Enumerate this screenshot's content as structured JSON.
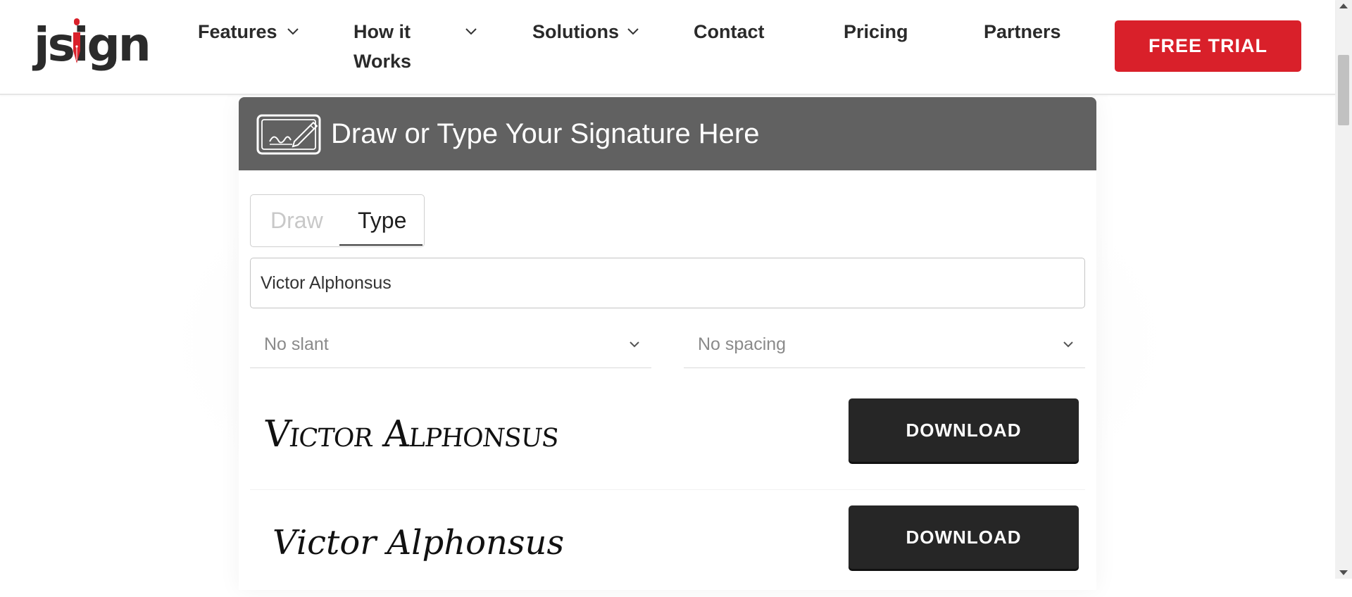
{
  "brand": {
    "logo_text": "jsign",
    "accent_color": "#d9202a"
  },
  "nav": {
    "items": [
      {
        "label": "Features",
        "has_dropdown": true
      },
      {
        "label": "How it Works",
        "has_dropdown": true
      },
      {
        "label": "Solutions",
        "has_dropdown": true
      },
      {
        "label": "Contact",
        "has_dropdown": false
      },
      {
        "label": "Pricing",
        "has_dropdown": false
      },
      {
        "label": "Partners",
        "has_dropdown": false
      }
    ],
    "cta_label": "FREE TRIAL"
  },
  "card": {
    "title": "Draw or Type Your Signature Here",
    "header_icon": "signature-pad-icon",
    "tabs": [
      {
        "label": "Draw",
        "active": false
      },
      {
        "label": "Type",
        "active": true
      }
    ],
    "name_input": {
      "value": "Victor Alphonsus"
    },
    "slant_select": {
      "selected": "No slant"
    },
    "spacing_select": {
      "selected": "No spacing"
    },
    "signatures": [
      {
        "text": "Victor Alphonsus",
        "download_label": "DOWNLOAD"
      },
      {
        "text": "Victor Alphonsus",
        "download_label": "DOWNLOAD"
      }
    ]
  }
}
